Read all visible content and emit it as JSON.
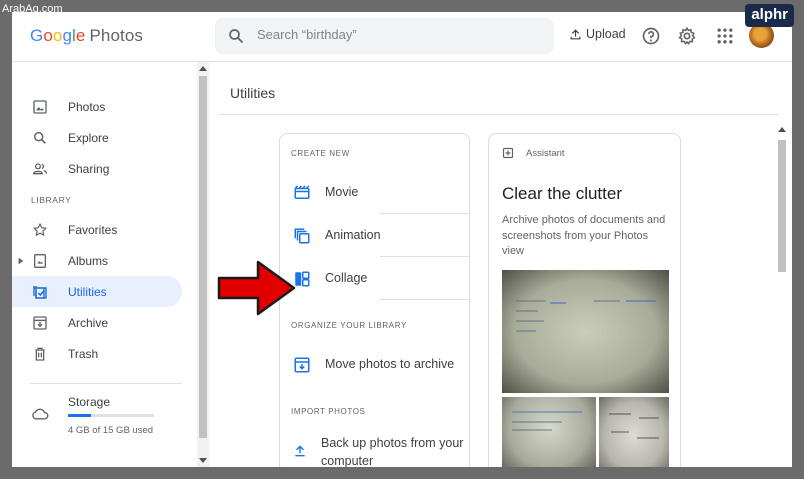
{
  "watermark": "ArabAq.com",
  "badge": "alphr",
  "header": {
    "logo_google": [
      "G",
      "o",
      "o",
      "g",
      "l",
      "e"
    ],
    "logo_photos": "Photos",
    "search_placeholder": "Search “birthday”",
    "upload_label": "Upload",
    "icons": [
      "help-icon",
      "settings-icon",
      "apps-icon",
      "avatar"
    ]
  },
  "sidebar": {
    "items": [
      {
        "label": "Photos",
        "icon": "photo-icon"
      },
      {
        "label": "Explore",
        "icon": "search-icon"
      },
      {
        "label": "Sharing",
        "icon": "people-icon"
      }
    ],
    "library_label": "LIBRARY",
    "library_items": [
      {
        "label": "Favorites",
        "icon": "star-icon"
      },
      {
        "label": "Albums",
        "icon": "album-icon"
      },
      {
        "label": "Utilities",
        "icon": "utilities-icon",
        "active": true
      },
      {
        "label": "Archive",
        "icon": "archive-icon"
      },
      {
        "label": "Trash",
        "icon": "trash-icon"
      }
    ],
    "storage": {
      "label": "Storage",
      "used_text": "4 GB of 15 GB used",
      "used_fraction": 0.27
    }
  },
  "main": {
    "title": "Utilities",
    "create_new": {
      "section_label": "CREATE NEW",
      "items": [
        {
          "label": "Movie",
          "icon": "movie-icon"
        },
        {
          "label": "Animation",
          "icon": "animation-icon"
        },
        {
          "label": "Collage",
          "icon": "collage-icon"
        }
      ]
    },
    "organize": {
      "section_label": "ORGANIZE YOUR LIBRARY",
      "items": [
        {
          "label": "Move photos to archive",
          "icon": "archive-move-icon"
        }
      ]
    },
    "import": {
      "section_label": "IMPORT PHOTOS",
      "items": [
        {
          "label": "Back up photos from your computer",
          "icon": "upload-icon"
        }
      ]
    },
    "assistant": {
      "tag": "Assistant",
      "title": "Clear the clutter",
      "description": "Archive photos of documents and screenshots from your Photos view"
    }
  },
  "colors": {
    "accent": "#1a73e8",
    "active_bg": "#e8f0fe",
    "arrow": "#e00000"
  }
}
